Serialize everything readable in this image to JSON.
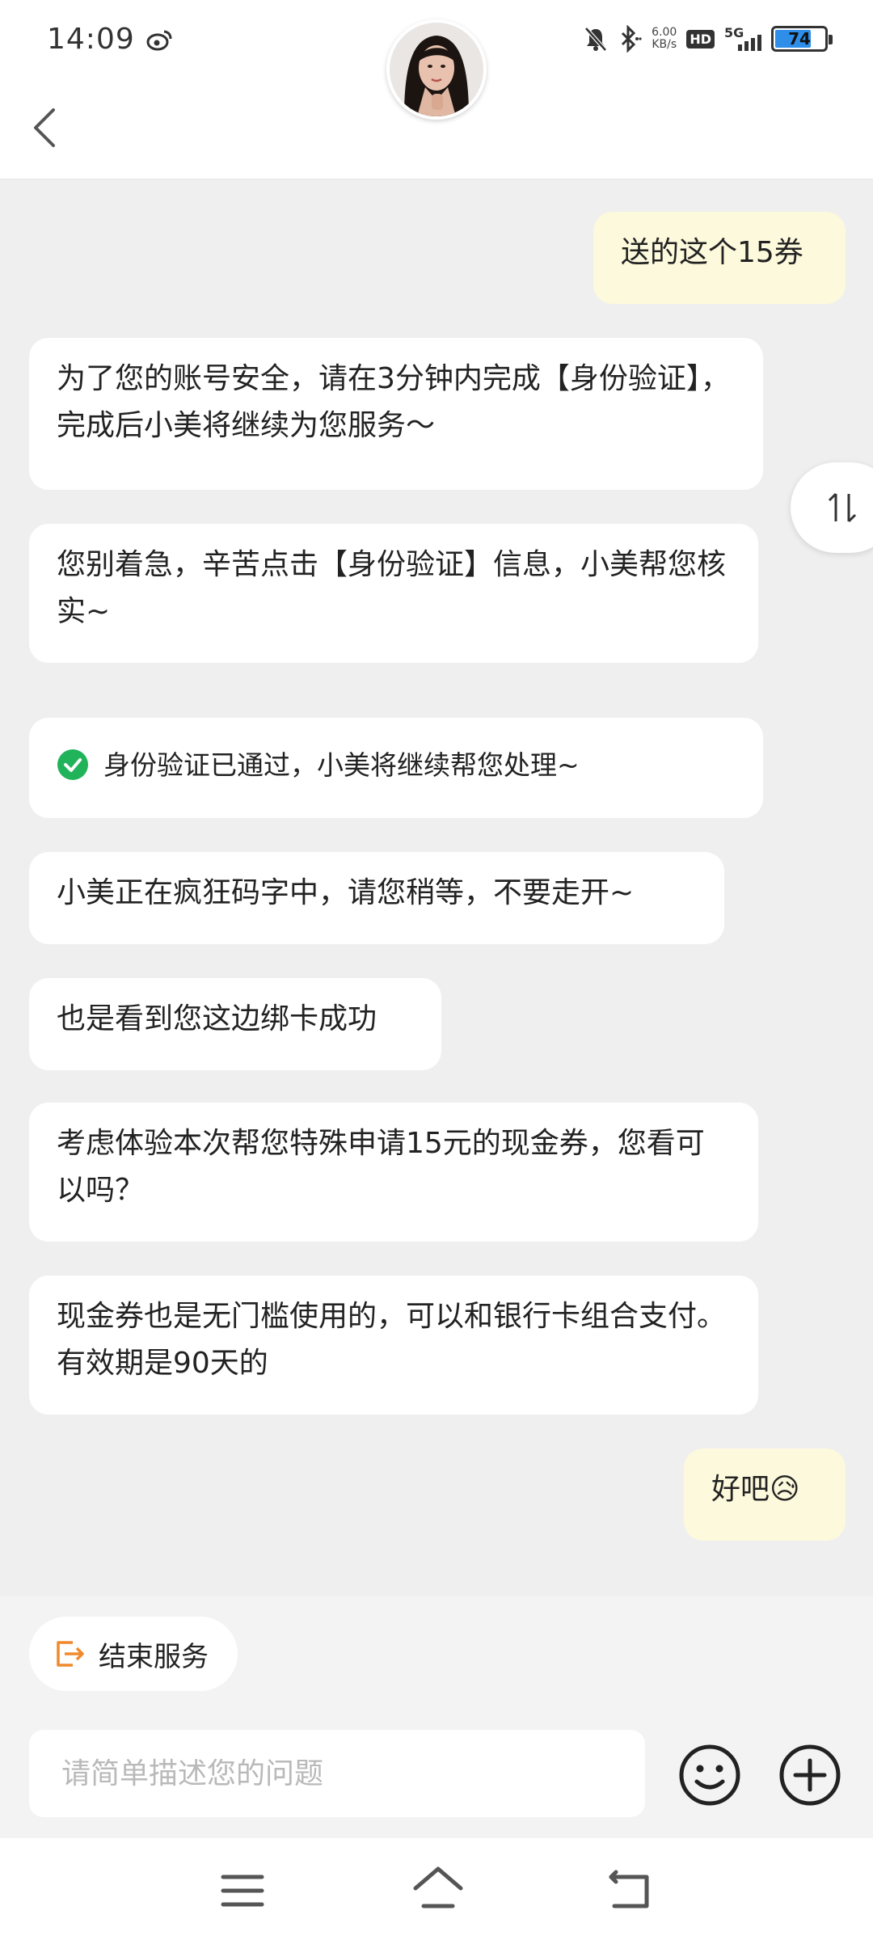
{
  "status_bar": {
    "time": "14:09",
    "net_speed_value": "6.00",
    "net_speed_unit": "KB/s",
    "hd_label": "HD",
    "network_label": "5G",
    "battery_level": "74",
    "icons": [
      "weibo-icon",
      "mute-icon",
      "bluetooth-icon",
      "hd-icon",
      "signal-icon",
      "battery-icon"
    ]
  },
  "header": {
    "back_icon": "chevron-left-icon",
    "avatar": "agent-avatar"
  },
  "messages": [
    {
      "sender": "user",
      "text": "送的这个15券"
    },
    {
      "sender": "agent",
      "text": "为了您的账号安全，请在3分钟内完成【身份验证】，完成后小美将继续为您服务～"
    },
    {
      "sender": "agent",
      "text": "您别着急，辛苦点击【身份验证】信息，小美帮您核实~"
    },
    {
      "sender": "agent",
      "text": "身份验证已通过，小美将继续帮您处理~",
      "icon": "check-circle-icon"
    },
    {
      "sender": "agent",
      "text": "小美正在疯狂码字中，请您稍等，不要走开~"
    },
    {
      "sender": "agent",
      "text": "也是看到您这边绑卡成功"
    },
    {
      "sender": "agent",
      "text": "考虑体验本次帮您特殊申请15元的现金券，您看可以吗？"
    },
    {
      "sender": "agent",
      "text": "现金券也是无门槛使用的，可以和银行卡组合支付。有效期是90天的"
    },
    {
      "sender": "user",
      "text": "好吧😥"
    }
  ],
  "bottom": {
    "end_service_label": "结束服务",
    "input_placeholder": "请简单描述您的问题",
    "emoji_icon": "emoji-icon",
    "plus_icon": "plus-icon",
    "swap_icon": "swap-arrows-icon"
  },
  "colors": {
    "user_bubble": "#fdf9dc",
    "agent_bubble": "#ffffff",
    "background": "#efefef",
    "accent_orange": "#f0892c",
    "verified_green": "#21b35a",
    "battery_blue": "#2e8ee8"
  }
}
